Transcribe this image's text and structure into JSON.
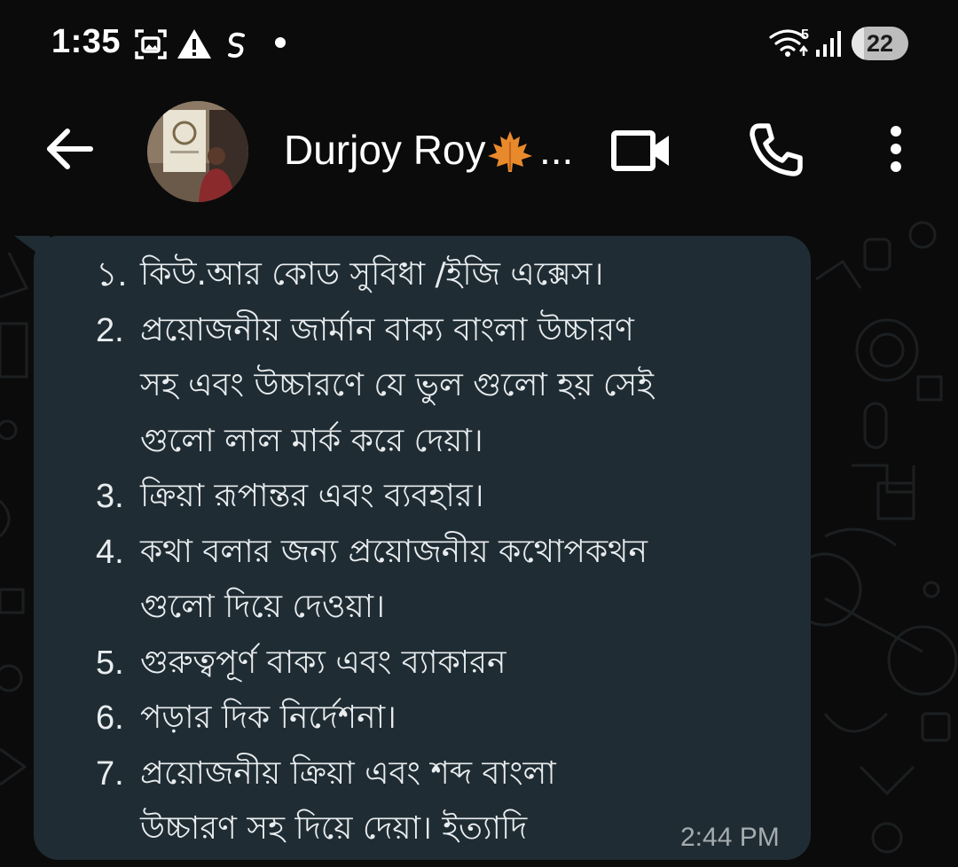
{
  "status_bar": {
    "time": "1:35",
    "network_badge": "5",
    "battery_level": "22",
    "battery_percent": 22
  },
  "header": {
    "contact_name": "Durjoy Roy",
    "name_truncation": "..."
  },
  "message": {
    "items": [
      {
        "number": "১.",
        "lines": [
          "কিউ.আর কোড সুবিধা /ইজি এক্সেস।"
        ]
      },
      {
        "number": "2.",
        "lines": [
          "প্রয়োজনীয় জার্মান বাক্য বাংলা উচ্চারণ",
          "সহ এবং উচ্চারণে যে ভুল গুলো হয় সেই",
          "গুলো লাল মার্ক করে দেয়া।"
        ]
      },
      {
        "number": "3.",
        "lines": [
          "ক্রিয়া রূপান্তর এবং ব্যবহার।"
        ]
      },
      {
        "number": "4.",
        "lines": [
          "কথা বলার জন্য প্রয়োজনীয় কথোপকথন",
          "গুলো দিয়ে দেওয়া।"
        ]
      },
      {
        "number": "5.",
        "lines": [
          "গুরুত্বপূর্ণ বাক্য এবং ব্যাকারন"
        ]
      },
      {
        "number": "6.",
        "lines": [
          "পড়ার দিক নির্দেশনা।"
        ]
      },
      {
        "number": "7.",
        "lines": [
          "প্রয়োজনীয় ক্রিয়া এবং শব্দ বাংলা",
          "উচ্চারণ সহ দিয়ে দেয়া। ইত্যাদি"
        ]
      }
    ],
    "timestamp": "2:44 PM"
  },
  "colors": {
    "background": "#0b0b0b",
    "bubble": "#1f2c33",
    "text": "#e9edef",
    "timestamp": "#a5acb0",
    "leaf": "#e8892b"
  },
  "icons": [
    "screenshot-icon",
    "warning-icon",
    "payment-icon",
    "wifi-icon",
    "signal-icon",
    "back-arrow-icon",
    "maple-leaf-icon",
    "video-call-icon",
    "phone-icon",
    "more-vert-icon"
  ]
}
